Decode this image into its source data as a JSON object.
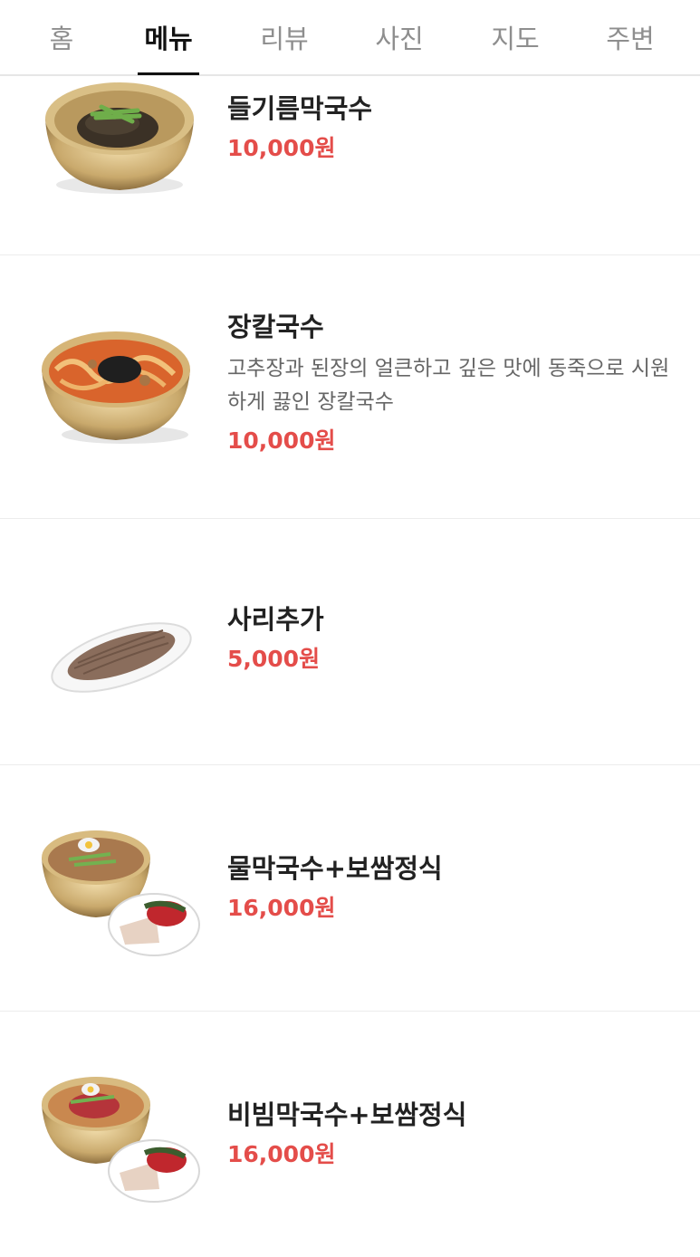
{
  "tabs": [
    {
      "label": "홈",
      "active": false
    },
    {
      "label": "메뉴",
      "active": true
    },
    {
      "label": "리뷰",
      "active": false
    },
    {
      "label": "사진",
      "active": false
    },
    {
      "label": "지도",
      "active": false
    },
    {
      "label": "주변",
      "active": false
    }
  ],
  "menu": [
    {
      "name": "들기름막국수",
      "price": "10,000원",
      "image_icon": "perilla-oil-noodle-bowl-image"
    },
    {
      "name": "장칼국수",
      "description": "고추장과 된장의 얼큰하고 깊은 맛에 동죽으로 시원하게 끓인 장칼국수",
      "price": "10,000원",
      "image_icon": "jang-kalguksu-bowl-image"
    },
    {
      "name": "사리추가",
      "price": "5,000원",
      "image_icon": "noodle-plate-image"
    },
    {
      "name": "물막국수+보쌈정식",
      "price": "16,000원",
      "image_icon": "cold-noodle-bossam-set-image"
    },
    {
      "name": "비빔막국수+보쌈정식",
      "price": "16,000원",
      "image_icon": "spicy-noodle-bossam-set-image"
    }
  ],
  "colors": {
    "price": "#e44d4a",
    "active_tab": "#111111",
    "inactive_tab": "#8e8e8e",
    "divider": "#ececec"
  }
}
